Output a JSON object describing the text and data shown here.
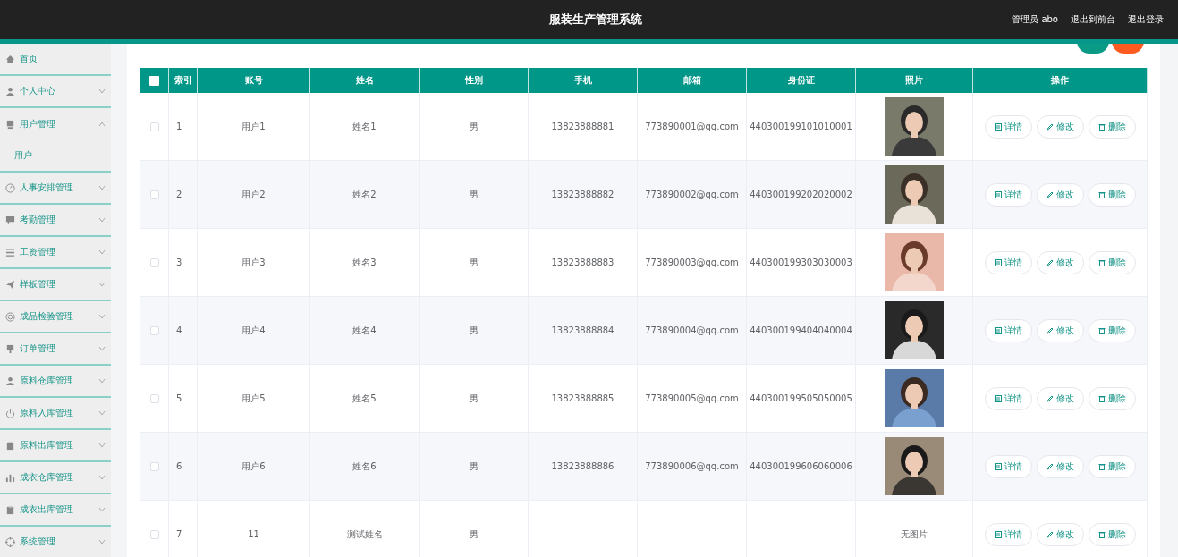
{
  "header": {
    "title": "服装生产管理系统",
    "user": "管理员 abo",
    "links": [
      "退出到前台",
      "退出登录"
    ]
  },
  "sidebar": {
    "items": [
      {
        "label": "首页",
        "kind": "link"
      },
      {
        "label": "个人中心",
        "kind": "menu",
        "expanded": false
      },
      {
        "label": "用户管理",
        "kind": "menu",
        "expanded": true,
        "children": [
          {
            "label": "用户",
            "selected": true
          }
        ]
      },
      {
        "label": "人事安排管理",
        "kind": "menu",
        "expanded": false
      },
      {
        "label": "考勤管理",
        "kind": "menu",
        "expanded": false
      },
      {
        "label": "工资管理",
        "kind": "menu",
        "expanded": false
      },
      {
        "label": "样板管理",
        "kind": "menu",
        "expanded": false
      },
      {
        "label": "成品检验管理",
        "kind": "menu",
        "expanded": false
      },
      {
        "label": "订单管理",
        "kind": "menu",
        "expanded": false
      },
      {
        "label": "原料仓库管理",
        "kind": "menu",
        "expanded": false
      },
      {
        "label": "原料入库管理",
        "kind": "menu",
        "expanded": false
      },
      {
        "label": "原料出库管理",
        "kind": "menu",
        "expanded": false
      },
      {
        "label": "成衣仓库管理",
        "kind": "menu",
        "expanded": false
      },
      {
        "label": "成衣出库管理",
        "kind": "menu",
        "expanded": false
      },
      {
        "label": "系统管理",
        "kind": "menu",
        "expanded": false
      }
    ]
  },
  "table": {
    "select_all": {
      "checked": false
    },
    "columns": [
      "索引",
      "账号",
      "姓名",
      "性别",
      "手机",
      "邮箱",
      "身份证",
      "照片",
      "操作"
    ],
    "rows": [
      {
        "checked": false,
        "index": "1",
        "account": "用户1",
        "name": "姓名1",
        "gender": "男",
        "phone": "13823888881",
        "email": "773890001@qq.com",
        "id_card": "440300199101010001",
        "actions": [
          "详情",
          "修改",
          "删除"
        ]
      },
      {
        "checked": false,
        "index": "2",
        "account": "用户2",
        "name": "姓名2",
        "gender": "男",
        "phone": "13823888882",
        "email": "773890002@qq.com",
        "id_card": "440300199202020002",
        "actions": [
          "详情",
          "修改",
          "删除"
        ]
      },
      {
        "checked": false,
        "index": "3",
        "account": "用户3",
        "name": "姓名3",
        "gender": "男",
        "phone": "13823888883",
        "email": "773890003@qq.com",
        "id_card": "440300199303030003",
        "actions": [
          "详情",
          "修改",
          "删除"
        ]
      },
      {
        "checked": false,
        "index": "4",
        "account": "用户4",
        "name": "姓名4",
        "gender": "男",
        "phone": "13823888884",
        "email": "773890004@qq.com",
        "id_card": "440300199404040004",
        "actions": [
          "详情",
          "修改",
          "删除"
        ]
      },
      {
        "checked": false,
        "index": "5",
        "account": "用户5",
        "name": "姓名5",
        "gender": "男",
        "phone": "13823888885",
        "email": "773890005@qq.com",
        "id_card": "440300199505050005",
        "actions": [
          "详情",
          "修改",
          "删除"
        ]
      },
      {
        "checked": false,
        "index": "6",
        "account": "用户6",
        "name": "姓名6",
        "gender": "男",
        "phone": "13823888886",
        "email": "773890006@qq.com",
        "id_card": "440300199606060006",
        "actions": [
          "详情",
          "修改",
          "删除"
        ]
      },
      {
        "checked": false,
        "index": "7",
        "account": "11",
        "name": "测试姓名",
        "gender": "男",
        "photo": {
          "kind": "none",
          "text": "无图片"
        },
        "actions": [
          "详情",
          "修改",
          "删除"
        ]
      }
    ]
  }
}
